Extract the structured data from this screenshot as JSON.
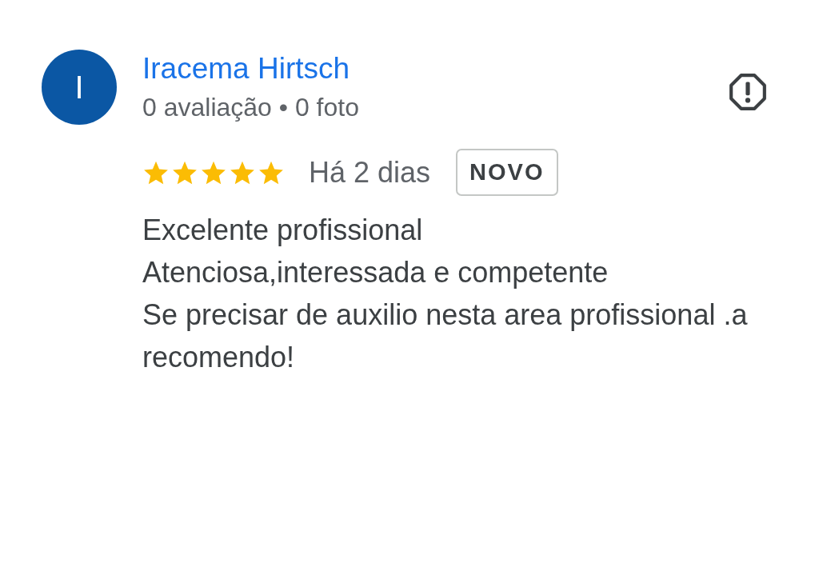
{
  "review": {
    "avatar_letter": "I",
    "author": "Iracema Hirtsch",
    "stats": "0 avaliação • 0 foto",
    "stars": 5,
    "time": "Há 2 dias",
    "badge": "NOVO",
    "text": "Excelente profissional\nAtenciosa,interessada e competente\nSe precisar de auxilio nesta area profissional .a recomendo!"
  }
}
